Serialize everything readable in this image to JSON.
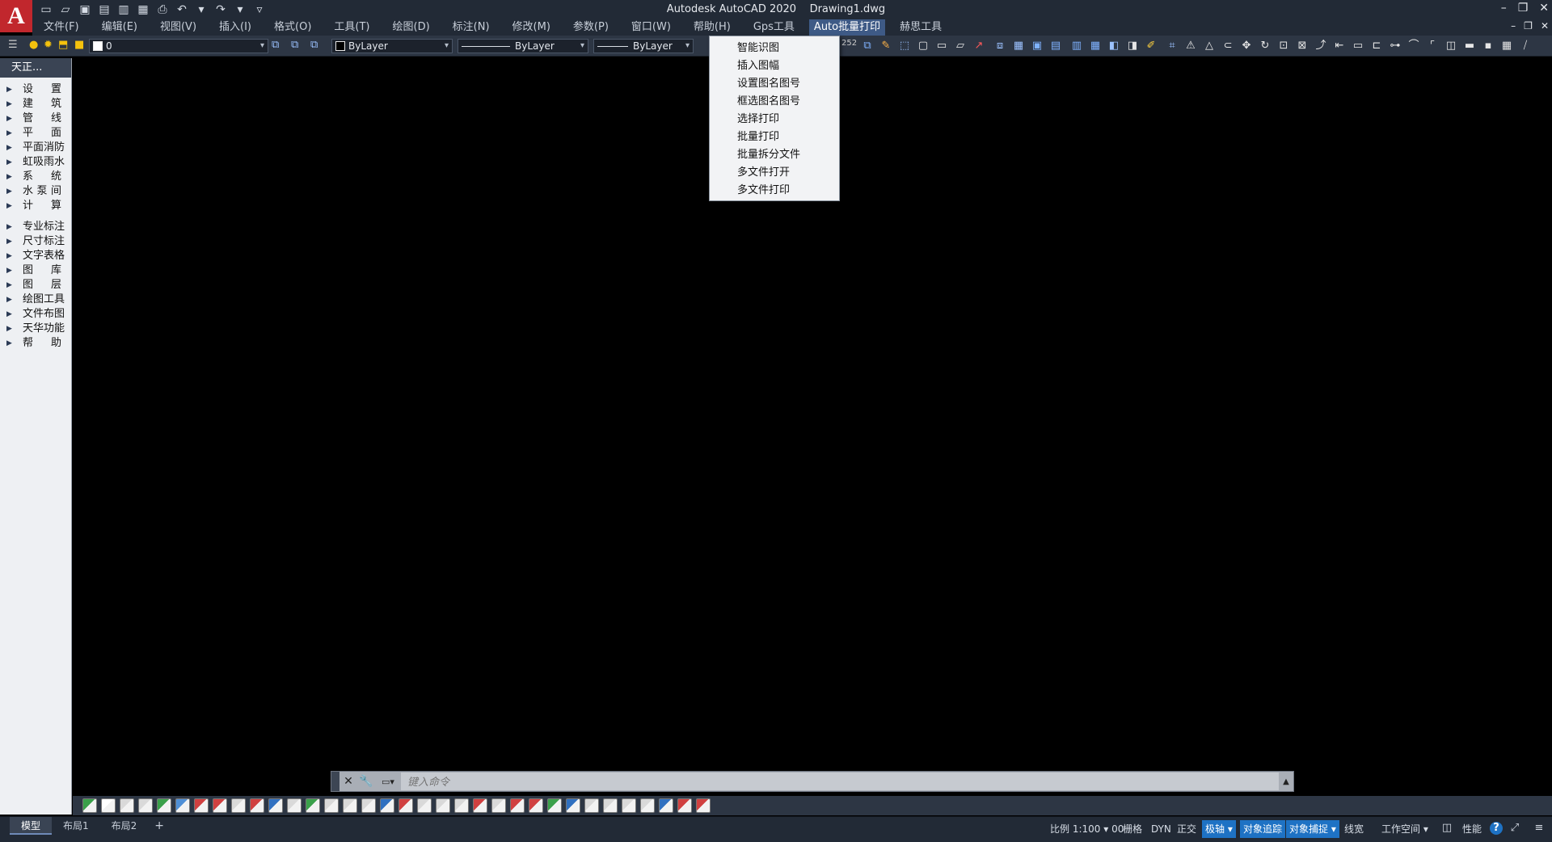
{
  "window": {
    "app_title": "Autodesk AutoCAD 2020",
    "file_name": "Drawing1.dwg",
    "logo_letter": "A"
  },
  "menubar": {
    "items": [
      "文件(F)",
      "编辑(E)",
      "视图(V)",
      "插入(I)",
      "格式(O)",
      "工具(T)",
      "绘图(D)",
      "标注(N)",
      "修改(M)",
      "参数(P)",
      "窗口(W)",
      "帮助(H)",
      "Gps工具",
      "Auto批量打印",
      "赫思工具"
    ],
    "active": "Auto批量打印"
  },
  "toolbar": {
    "layer_value": "0",
    "color_value": "ByLayer",
    "linetype_value": "ByLayer",
    "lineweight_value": "ByLayer",
    "stylescale_value": "252"
  },
  "dropdown": {
    "items": [
      "智能识图",
      "插入图幅",
      "设置图名图号",
      "框选图名图号",
      "选择打印",
      "批量打印",
      "批量拆分文件",
      "多文件打开",
      "多文件打印"
    ]
  },
  "palette": {
    "title": "天正...",
    "group1": [
      "设 置",
      "建 筑",
      "管 线",
      "平 面",
      "平面消防",
      "虹吸雨水",
      "系 统",
      "水 泵 间",
      "计 算"
    ],
    "group2": [
      "专业标注",
      "尺寸标注",
      "文字表格",
      "图 库",
      "图 层",
      "绘图工具",
      "文件布图",
      "天华功能",
      "帮 助"
    ]
  },
  "command_line": {
    "placeholder": "键入命令"
  },
  "status": {
    "tabs": [
      "模型",
      "布局1",
      "布局2"
    ],
    "active_tab": "模型",
    "scale": "比例 1:100",
    "zero": "00",
    "grid": "栅格",
    "dyn": "DYN",
    "ortho": "正交",
    "polar": "极轴",
    "otrack": "对象追踪",
    "osnap": "对象捕捉",
    "lineweight": "线宽",
    "workspace": "工作空间",
    "performance": "性能"
  },
  "colors": {
    "title_bg": "#222a36",
    "toolbar_bg": "#2d3644",
    "active_menu": "#3e5a86",
    "status_on": "#1e72c4",
    "logo_red": "#c1272d"
  }
}
